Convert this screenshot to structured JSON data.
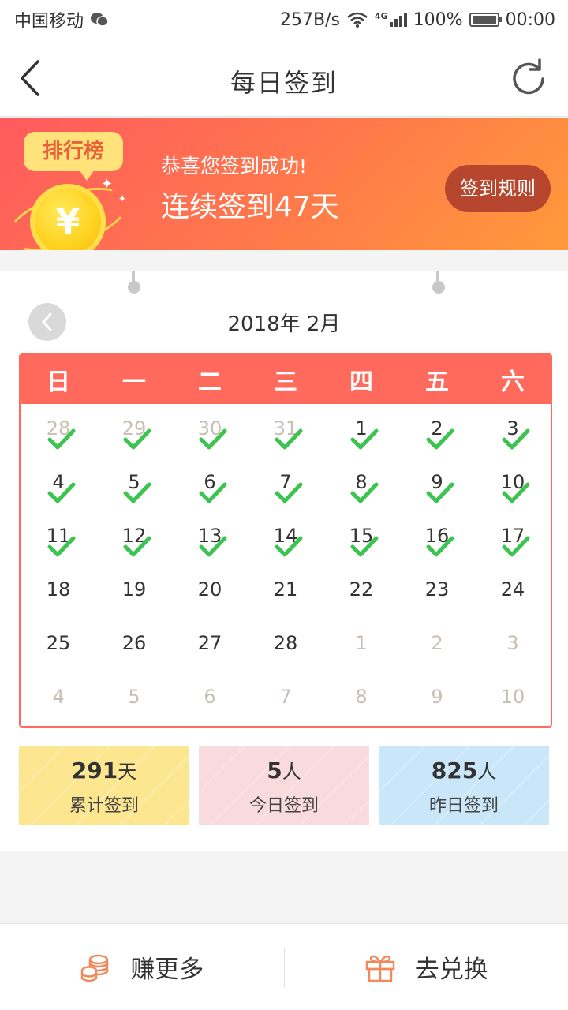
{
  "status_bar": {
    "carrier": "中国移动",
    "speed": "257B/s",
    "network": "4G",
    "battery": "100%",
    "time": "00:00"
  },
  "nav": {
    "title": "每日签到"
  },
  "banner": {
    "rank_label": "排行榜",
    "coin_symbol": "¥",
    "message": "恭喜您签到成功!",
    "streak": "连续签到47天",
    "rules_button": "签到规则"
  },
  "calendar": {
    "month_label": "2018年 2月",
    "weekdays": [
      "日",
      "一",
      "二",
      "三",
      "四",
      "五",
      "六"
    ],
    "days": [
      {
        "d": "28",
        "other": true,
        "checked": true
      },
      {
        "d": "29",
        "other": true,
        "checked": true
      },
      {
        "d": "30",
        "other": true,
        "checked": true
      },
      {
        "d": "31",
        "other": true,
        "checked": true
      },
      {
        "d": "1",
        "other": false,
        "checked": true
      },
      {
        "d": "2",
        "other": false,
        "checked": true
      },
      {
        "d": "3",
        "other": false,
        "checked": true
      },
      {
        "d": "4",
        "other": false,
        "checked": true
      },
      {
        "d": "5",
        "other": false,
        "checked": true
      },
      {
        "d": "6",
        "other": false,
        "checked": true
      },
      {
        "d": "7",
        "other": false,
        "checked": true
      },
      {
        "d": "8",
        "other": false,
        "checked": true
      },
      {
        "d": "9",
        "other": false,
        "checked": true
      },
      {
        "d": "10",
        "other": false,
        "checked": true
      },
      {
        "d": "11",
        "other": false,
        "checked": true
      },
      {
        "d": "12",
        "other": false,
        "checked": true
      },
      {
        "d": "13",
        "other": false,
        "checked": true
      },
      {
        "d": "14",
        "other": false,
        "checked": true
      },
      {
        "d": "15",
        "other": false,
        "checked": true
      },
      {
        "d": "16",
        "other": false,
        "checked": true
      },
      {
        "d": "17",
        "other": false,
        "checked": true
      },
      {
        "d": "18",
        "other": false,
        "checked": false
      },
      {
        "d": "19",
        "other": false,
        "checked": false
      },
      {
        "d": "20",
        "other": false,
        "checked": false
      },
      {
        "d": "21",
        "other": false,
        "checked": false
      },
      {
        "d": "22",
        "other": false,
        "checked": false
      },
      {
        "d": "23",
        "other": false,
        "checked": false
      },
      {
        "d": "24",
        "other": false,
        "checked": false
      },
      {
        "d": "25",
        "other": false,
        "checked": false
      },
      {
        "d": "26",
        "other": false,
        "checked": false
      },
      {
        "d": "27",
        "other": false,
        "checked": false
      },
      {
        "d": "28",
        "other": false,
        "checked": false
      },
      {
        "d": "1",
        "other": true,
        "checked": false
      },
      {
        "d": "2",
        "other": true,
        "checked": false
      },
      {
        "d": "3",
        "other": true,
        "checked": false
      },
      {
        "d": "4",
        "other": true,
        "checked": false
      },
      {
        "d": "5",
        "other": true,
        "checked": false
      },
      {
        "d": "6",
        "other": true,
        "checked": false
      },
      {
        "d": "7",
        "other": true,
        "checked": false
      },
      {
        "d": "8",
        "other": true,
        "checked": false
      },
      {
        "d": "9",
        "other": true,
        "checked": false
      },
      {
        "d": "10",
        "other": true,
        "checked": false
      }
    ]
  },
  "stats": [
    {
      "num": "291",
      "unit": "天",
      "label": "累计签到",
      "color": "#fde690"
    },
    {
      "num": "5",
      "unit": "人",
      "label": "今日签到",
      "color": "#f9dadd"
    },
    {
      "num": "825",
      "unit": "人",
      "label": "昨日签到",
      "color": "#c9e7f8"
    }
  ],
  "bottom": {
    "earn_label": "赚更多",
    "exchange_label": "去兑换"
  },
  "colors": {
    "accent": "#ff6a5c",
    "check": "#3cc451",
    "icon_orange": "#f08a5d"
  },
  "icons": {
    "back": "back-arrow-icon",
    "refresh": "refresh-icon",
    "coin": "coin-icon",
    "wechat": "wechat-icon",
    "wifi": "wifi-icon",
    "signal": "signal-icon",
    "battery": "battery-icon",
    "coins_stack": "coins-stack-icon",
    "gift": "gift-icon",
    "check": "check-icon",
    "prev": "chevron-left-icon"
  }
}
